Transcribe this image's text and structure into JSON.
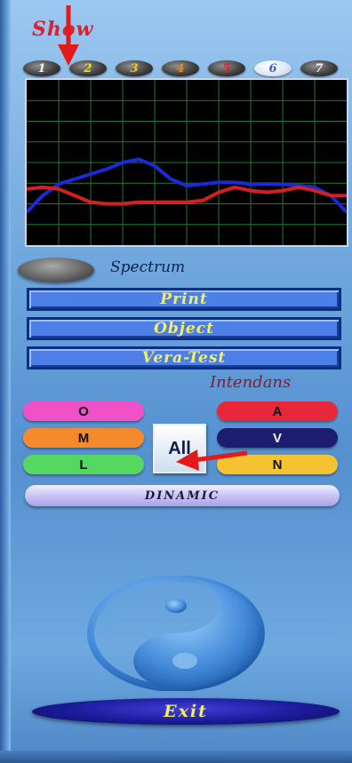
{
  "header": {
    "title": "Show"
  },
  "channels": [
    {
      "label": "1",
      "color": "#f2f2f2",
      "selected": false
    },
    {
      "label": "2",
      "color": "#f4df2a",
      "selected": false
    },
    {
      "label": "3",
      "color": "#f4c81e",
      "selected": false
    },
    {
      "label": "4",
      "color": "#f08a1c",
      "selected": false
    },
    {
      "label": "5",
      "color": "#e0202a",
      "selected": false
    },
    {
      "label": "6",
      "color": "#3a5fc4",
      "selected": true
    },
    {
      "label": "7",
      "color": "#ffffff",
      "selected": false
    }
  ],
  "spectrum": {
    "label": "Spectrum"
  },
  "menu": {
    "print_label": "Print",
    "object_label": "Object",
    "vera_test_label": "Vera-Test"
  },
  "intendans": {
    "label": "Intendans",
    "buttons": [
      {
        "label": "O",
        "color": "#f050c8"
      },
      {
        "label": "M",
        "color": "#f58a2a"
      },
      {
        "label": "L",
        "color": "#54d860"
      },
      {
        "label": "A",
        "color": "#e8283a"
      },
      {
        "label": "V",
        "color": "#1c1c70"
      },
      {
        "label": "N",
        "color": "#f5c230"
      }
    ],
    "all_label": "All"
  },
  "dinamic_label": "DINAMIC",
  "exit_label": "Exit",
  "chart_data": {
    "type": "line",
    "grid": true,
    "x": [
      0,
      1,
      2,
      3,
      4,
      5,
      6,
      7,
      8,
      9,
      10,
      11,
      12,
      13,
      14,
      15,
      16,
      17,
      18,
      19,
      20
    ],
    "ylim": [
      0,
      100
    ],
    "series": [
      {
        "color": "#1a2ad8",
        "values": [
          20,
          30,
          37,
          40,
          43,
          46,
          50,
          52,
          48,
          40,
          36,
          37,
          38,
          38,
          37,
          37,
          37,
          36,
          35,
          30,
          20
        ]
      },
      {
        "color": "#d42020",
        "values": [
          34,
          35,
          34,
          30,
          26,
          25,
          25,
          26,
          26,
          26,
          26,
          27,
          32,
          35,
          33,
          32,
          33,
          35,
          33,
          30,
          30
        ]
      }
    ]
  }
}
